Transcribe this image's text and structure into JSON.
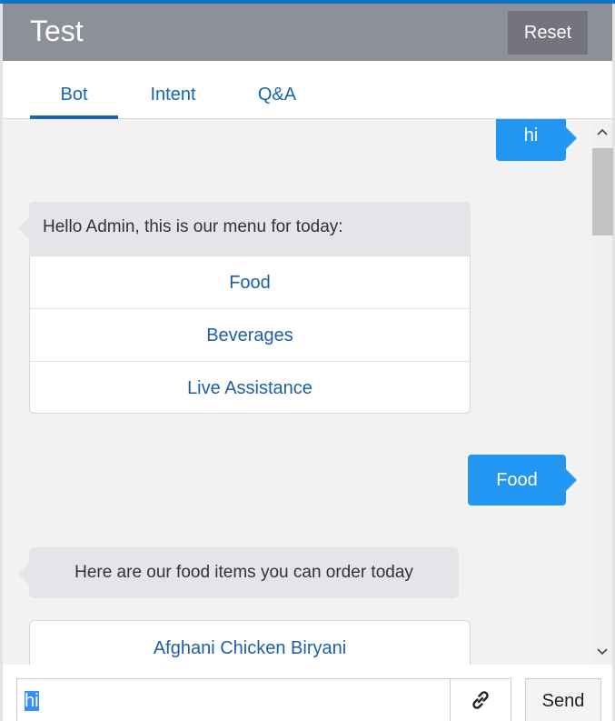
{
  "header": {
    "title": "Test",
    "reset_label": "Reset"
  },
  "tabs": [
    {
      "label": "Bot",
      "active": true
    },
    {
      "label": "Intent",
      "active": false
    },
    {
      "label": "Q&A",
      "active": false
    }
  ],
  "messages": {
    "user_1": "hi",
    "bot_menu": {
      "text": "Hello Admin, this is our menu for today:",
      "options": [
        "Food",
        "Beverages",
        "Live Assistance"
      ]
    },
    "user_2": "Food",
    "bot_food": {
      "text": "Here are our food items you can order today",
      "options": [
        "Afghani Chicken Biryani"
      ]
    }
  },
  "input": {
    "value": "hi",
    "send_label": "Send",
    "attach_icon": "link-icon"
  },
  "colors": {
    "accent": "#0f73c8",
    "header_bg": "#8e9099",
    "user_bubble": "#2196f3",
    "bot_bubble": "#e4e4e9",
    "link": "#1c5fa8"
  }
}
